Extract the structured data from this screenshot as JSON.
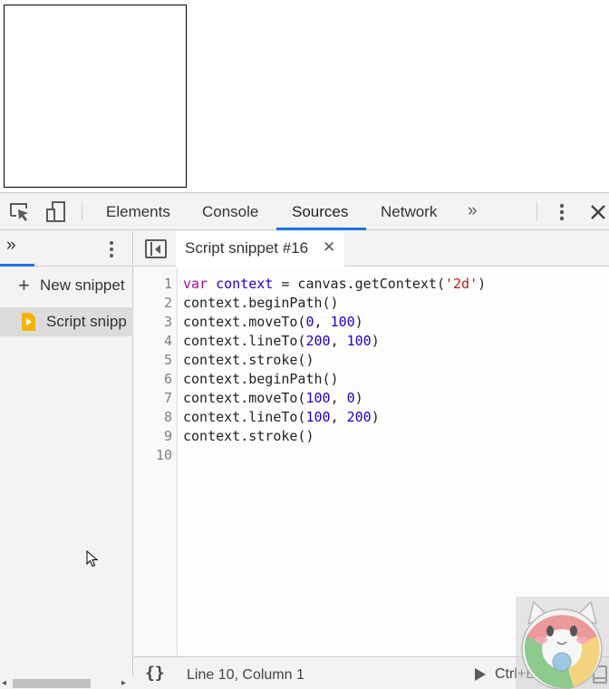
{
  "devtools": {
    "tabs": [
      {
        "label": "Elements",
        "active": false
      },
      {
        "label": "Console",
        "active": false
      },
      {
        "label": "Sources",
        "active": true
      },
      {
        "label": "Network",
        "active": false
      }
    ],
    "more_tabs": "»",
    "accent_color": "#1a73e8"
  },
  "navigator": {
    "tab_label": "»",
    "new_snippet_label": "New snippet",
    "snippets": [
      {
        "label": "Script snipp",
        "selected": true
      }
    ]
  },
  "editor": {
    "file_tab": {
      "label": "Script snippet #16",
      "close": "✕"
    },
    "line_numbers": [
      "1",
      "2",
      "3",
      "4",
      "5",
      "6",
      "7",
      "8",
      "9",
      "10"
    ],
    "status": {
      "pretty_print": "{}",
      "position": "Line 10, Column 1",
      "run_label": "Ctrl+Enter"
    }
  },
  "code": {
    "l1": {
      "kw": "var",
      "def": "context",
      "pre": " ",
      "mid": " = canvas.getContext(",
      "str": "'2d'",
      "post": ")"
    },
    "l2": "context.beginPath()",
    "l3": {
      "pre": "context.moveTo(",
      "a": "0",
      "sep": ", ",
      "b": "100",
      "post": ")"
    },
    "l4": {
      "pre": "context.lineTo(",
      "a": "200",
      "sep": ", ",
      "b": "100",
      "post": ")"
    },
    "l5": "context.stroke()",
    "l6": "context.beginPath()",
    "l7": {
      "pre": "context.moveTo(",
      "a": "100",
      "sep": ", ",
      "b": "0",
      "post": ")"
    },
    "l8": {
      "pre": "context.lineTo(",
      "a": "100",
      "sep": ", ",
      "b": "200",
      "post": ")"
    },
    "l9": "context.stroke()",
    "l10": ""
  }
}
